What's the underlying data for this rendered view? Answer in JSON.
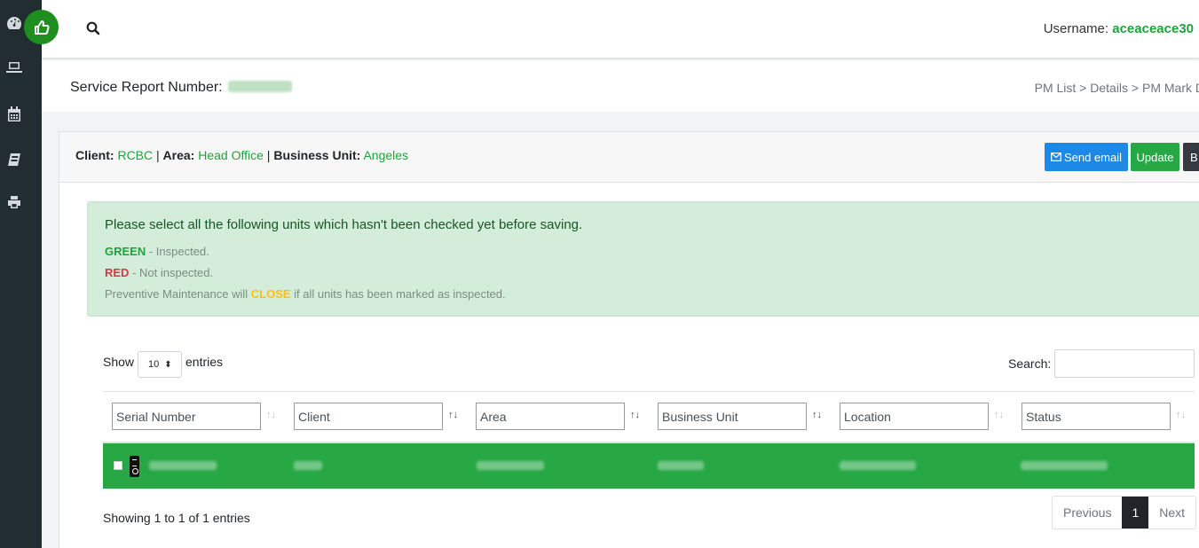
{
  "topbar": {
    "username_label": "Username:",
    "username_value": "aceaceace30"
  },
  "header": {
    "title": "Service Report Number:",
    "breadcrumb": "PM List > Details > PM Mark D"
  },
  "card": {
    "client_label": "Client:",
    "client_value": "RCBC",
    "sep1": "|",
    "area_label": "Area:",
    "area_value": "Head Office",
    "sep2": "|",
    "bu_label": "Business Unit:",
    "bu_value": "Angeles",
    "send_email": "Send email",
    "update": "Update",
    "back": "B"
  },
  "alert": {
    "title": "Please select all the following units which hasn't been checked yet before saving.",
    "green_word": "GREEN",
    "green_text": " - Inspected.",
    "red_word": "RED",
    "red_text": " - Not inspected.",
    "close_prefix": "Preventive Maintenance will ",
    "close_word": "CLOSE",
    "close_suffix": " if all units has been marked as inspected."
  },
  "table": {
    "show_label": "Show",
    "length_value": "10",
    "length_arrow": "⬍",
    "entries_label": "entries",
    "search_label": "Search:",
    "columns": [
      "Serial Number",
      "Client",
      "Area",
      "Business Unit",
      "Location",
      "Status"
    ],
    "info": "Showing 1 to 1 of 1 entries",
    "pager": {
      "previous": "Previous",
      "current": "1",
      "next": "Next"
    }
  },
  "colors": {
    "sidebar": "#222d32",
    "accent_green": "#28a745",
    "link_green": "#1fa33a",
    "primary_blue": "#1e88e5"
  }
}
